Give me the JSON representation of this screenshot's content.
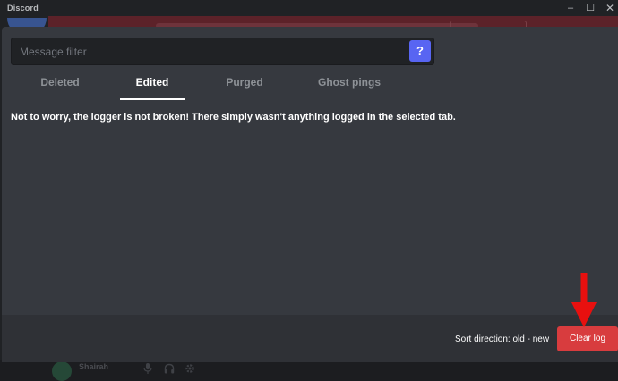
{
  "window": {
    "title": "Discord",
    "minimize_glyph": "–",
    "maximize_glyph": "☐",
    "close_glyph": "✕"
  },
  "filter": {
    "placeholder": "Message filter",
    "value": "",
    "help_label": "?"
  },
  "tabs": [
    {
      "label": "Deleted",
      "active": false
    },
    {
      "label": "Edited",
      "active": true
    },
    {
      "label": "Purged",
      "active": false
    },
    {
      "label": "Ghost pings",
      "active": false
    }
  ],
  "empty_message": "Not to worry, the logger is not broken! There simply wasn't anything logged in the selected tab.",
  "footer": {
    "sort_label": "Sort direction: old - new",
    "clear_button": "Clear log"
  },
  "background": {
    "user_name": "Shairah"
  },
  "colors": {
    "modal_bg": "#36393f",
    "footer_bg": "#2f3136",
    "accent": "#5865f2",
    "danger": "#d83c3e",
    "annotation_arrow": "#e8100f"
  },
  "icons": [
    "help-icon",
    "microphone-icon",
    "headphones-icon",
    "settings-gear-icon",
    "red-arrow-annotation"
  ]
}
